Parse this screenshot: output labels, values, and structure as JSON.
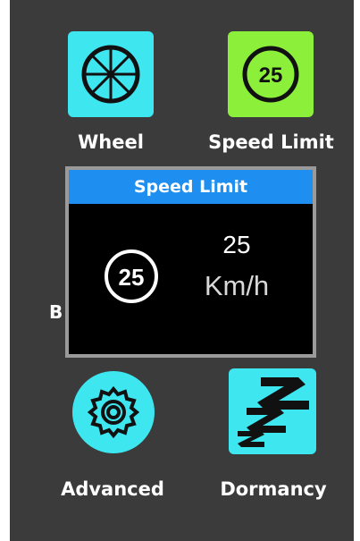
{
  "menu": {
    "items": [
      {
        "label": "Wheel",
        "icon": "wheel-icon",
        "color": "#3ee6f0"
      },
      {
        "label": "Speed Limit",
        "icon": "speed-limit-icon",
        "icon_text": "25",
        "color": "#8cf03a"
      },
      {
        "label": "Advanced",
        "icon": "gear-icon",
        "color": "#3ee6f0"
      },
      {
        "label": "Dormancy",
        "icon": "zzz-icon",
        "color": "#3ee6f0"
      }
    ],
    "hidden_label": "B"
  },
  "dialog": {
    "title": "Speed Limit",
    "icon_text": "25",
    "value": "25",
    "unit": "Km/h",
    "title_color": "#1e8ff0"
  }
}
